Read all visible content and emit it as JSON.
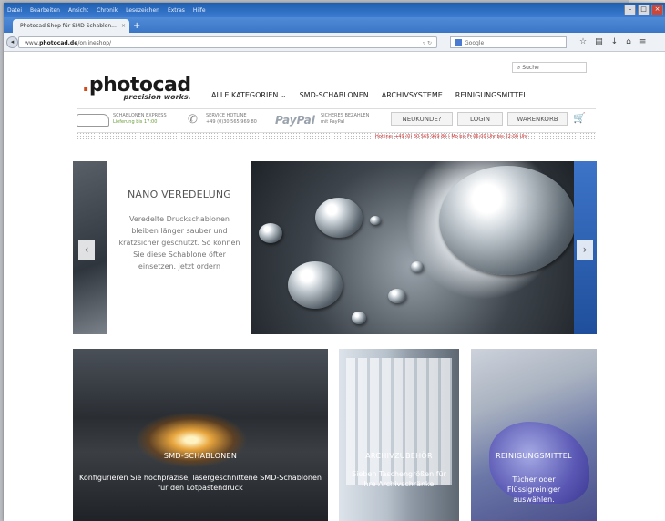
{
  "browser": {
    "menu": [
      "Datei",
      "Bearbeiten",
      "Ansicht",
      "Chronik",
      "Lesezeichen",
      "Extras",
      "Hilfe"
    ],
    "tab_title": "Photocad Shop für SMD Schablon...",
    "new_tab": "+",
    "url_prefix": "www.",
    "url_domain": "photocad.de",
    "url_path": "/onlineshop/",
    "search_placeholder": "Google"
  },
  "site": {
    "search_label": "Suche",
    "logo_word": "photocad",
    "logo_tagline": "precision works.",
    "nav": [
      "ALLE KATEGORIEN ⌄",
      "SMD-SCHABLONEN",
      "ARCHIVSYSTEME",
      "REINIGUNGSMITTEL"
    ],
    "info": {
      "express_title": "SCHABLONEN EXPRESS",
      "express_sub": "Lieferung bis 17:00",
      "hotline_title": "SERVICE HOTLINE",
      "hotline_sub": "+49 (0)30 565 969 80",
      "paypal": "PayPal",
      "pay_title": "SICHERES BEZAHLEN",
      "pay_sub": "mit PayPal"
    },
    "buttons": {
      "new_customer": "NEUKUNDE?",
      "login": "LOGIN",
      "cart": "WARENKORB"
    },
    "hotline_line": "Hotline: +49 (0) 30 565 969 80 | Mo bis Fr 06:00 Uhr bis 22:00 Uhr",
    "hero": {
      "title": "NANO VEREDELUNG",
      "body": "Veredelte Druckschablonen bleiben länger sauber und kratzsicher geschützt. So können Sie diese Schablone öfter einsetzen. jetzt ordern",
      "prev": "‹",
      "next": "›"
    },
    "tiles": [
      {
        "title": "SMD-SCHABLONEN",
        "desc": "Konfigurieren Sie hochpräzise, lasergeschnittene SMD-Schablonen für den Lotpastendruck"
      },
      {
        "title": "ARCHIVZUBEHÖR",
        "desc": "Sieben Taschengrößen für Ihre Archivschränke."
      },
      {
        "title": "REINIGUNGSMITTEL",
        "desc": "Tücher oder Flüssigreiniger auswählen."
      }
    ]
  },
  "colors": {
    "accent": "#d34a1a",
    "cart": "#d3302b",
    "browser_chrome": "#3a76c6"
  }
}
